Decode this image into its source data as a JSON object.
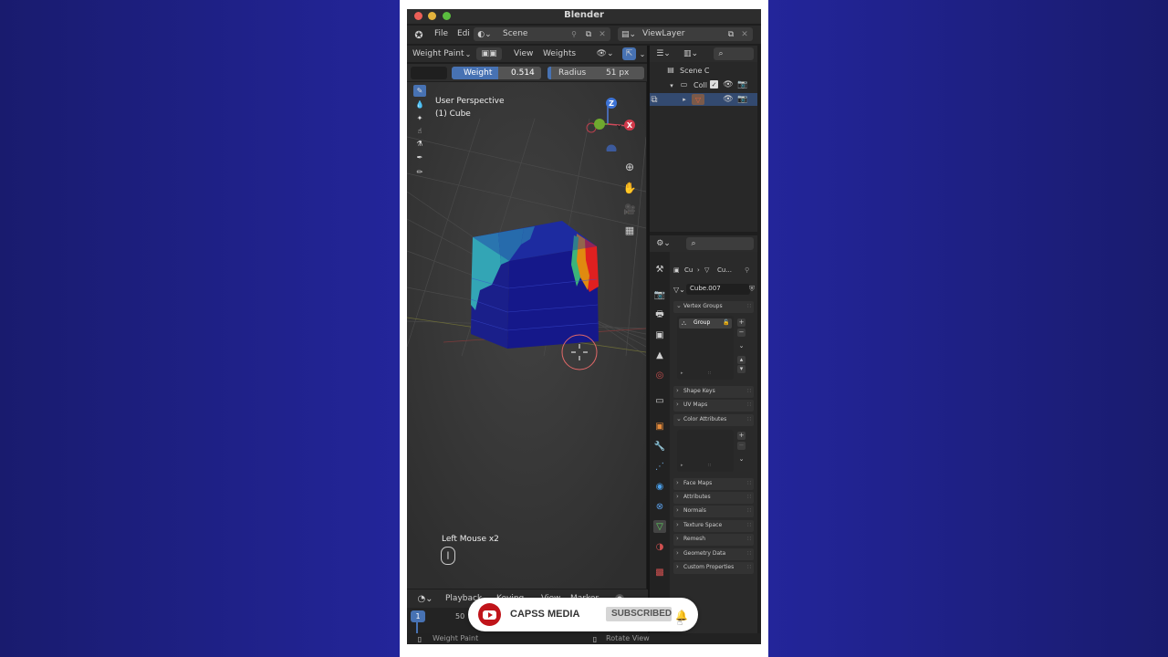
{
  "window": {
    "title": "Blender"
  },
  "topbar": {
    "menu_file": "File",
    "menu_edit": "Edi",
    "scene_name": "Scene",
    "view_layer": "ViewLayer"
  },
  "viewport_header": {
    "mode": "Weight Paint",
    "menu_view": "View",
    "menu_weights": "Weights"
  },
  "tool_settings": {
    "weight_label": "Weight",
    "weight_value": "0.514",
    "radius_label": "Radius",
    "radius_value": "51 px"
  },
  "viewport": {
    "perspective_label": "User Perspective",
    "object_label": "(1) Cube",
    "gizmo_z": "Z",
    "gizmo_y": "Y",
    "gizmo_x": "X",
    "input_hint": "Left Mouse x2"
  },
  "outliner": {
    "scene_label": "Scene C",
    "collection_label": "Coll"
  },
  "properties": {
    "breadcrumb_object": "Cu",
    "breadcrumb_mesh": "Cu...",
    "mesh_name": "Cube.007",
    "vertex_groups_label": "Vertex Groups",
    "vertex_group_item": "Group",
    "panels": [
      "Shape Keys",
      "UV Maps",
      "Color Attributes",
      "Face Maps",
      "Attributes",
      "Normals",
      "Texture Space",
      "Remesh",
      "Geometry Data",
      "Custom Properties"
    ]
  },
  "timeline": {
    "menu_playback": "Playback",
    "menu_keying": "Keying",
    "menu_view": "View",
    "menu_marker": "Marker",
    "current_frame": "1",
    "frame_marker": "50"
  },
  "statusbar": {
    "left_action": "Weight Paint",
    "right_action": "Rotate View"
  },
  "overlay": {
    "channel_name": "CAPSS MEDIA",
    "subscribe_label": "SUBSCRIBED"
  },
  "colors": {
    "accent_blue": "#4772b3",
    "background_blue": "#1b1d7a",
    "youtube_red": "#e02020"
  }
}
